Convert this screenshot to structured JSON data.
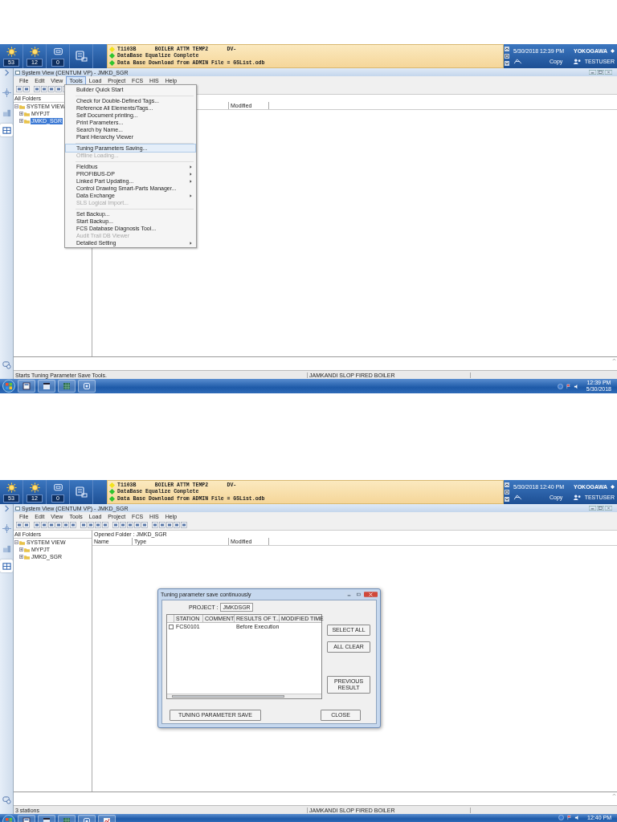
{
  "screens": [
    {
      "header": {
        "buttons": [
          {
            "kind": "alarm",
            "count": "53"
          },
          {
            "kind": "alarm",
            "count": "12"
          },
          {
            "kind": "message",
            "count": "0"
          },
          {
            "kind": "operator"
          }
        ],
        "messages": [
          {
            "text": "T1103B      BOILER ATTM TEMP2      DV-",
            "color": "#f2e21c"
          },
          {
            "text": "DataBase Equalize Complete",
            "color": "#2ec42e"
          },
          {
            "text": "Data Base Download from ADMIN File = GSList.odb",
            "color": "#2ec42e"
          }
        ],
        "datetime": "5/30/2018 12:39 PM",
        "brand": "YOKOGAWA",
        "copy": "Copy",
        "user": "TESTUSER"
      },
      "window": {
        "title": "System View (CENTUM VP) - JMKD_SGR",
        "menu": [
          {
            "label": "File",
            "selected": false
          },
          {
            "label": "Edit",
            "selected": false
          },
          {
            "label": "View",
            "selected": false
          },
          {
            "label": "Tools",
            "selected": true
          },
          {
            "label": "Load",
            "selected": false
          },
          {
            "label": "Project",
            "selected": false
          },
          {
            "label": "FCS",
            "selected": false
          },
          {
            "label": "HIS",
            "selected": false
          },
          {
            "label": "Help",
            "selected": false
          }
        ],
        "tree": {
          "label": "All Folders",
          "children": [
            {
              "label": "SYSTEM VIEW",
              "selected": false,
              "children": [
                {
                  "label": "MYPJT",
                  "selected": false
                },
                {
                  "label": "JMKD_SGR",
                  "selected": true
                }
              ]
            }
          ]
        },
        "columns": [
          {
            "kind": "modified",
            "label": "Modified"
          }
        ],
        "status_left": "Starts Tuning Parameter Save Tools.",
        "status_center": "JAMKANDI SLOP FIRED BOILER"
      },
      "dropdown": [
        {
          "kind": "item",
          "label": "Builder Quick Start",
          "selected": false,
          "disabled": false,
          "submenu": false
        },
        {
          "kind": "separator"
        },
        {
          "kind": "item",
          "label": "Check for Double-Defined Tags...",
          "selected": false,
          "disabled": false,
          "submenu": false
        },
        {
          "kind": "item",
          "label": "Reference All Elements/Tags...",
          "selected": false,
          "disabled": false,
          "submenu": false
        },
        {
          "kind": "item",
          "label": "Self Document printing...",
          "selected": false,
          "disabled": false,
          "submenu": false
        },
        {
          "kind": "item",
          "label": "Print Parameters...",
          "selected": false,
          "disabled": false,
          "submenu": false
        },
        {
          "kind": "item",
          "label": "Search by Name...",
          "selected": false,
          "disabled": false,
          "submenu": false
        },
        {
          "kind": "item",
          "label": "Plant Hierarchy Viewer",
          "selected": false,
          "disabled": false,
          "submenu": false
        },
        {
          "kind": "separator"
        },
        {
          "kind": "item",
          "label": "Tuning Parameters Saving...",
          "selected": true,
          "disabled": false,
          "submenu": false
        },
        {
          "kind": "item",
          "label": "Offline Loading...",
          "selected": false,
          "disabled": true,
          "submenu": false
        },
        {
          "kind": "separator"
        },
        {
          "kind": "item",
          "label": "Fieldbus",
          "selected": false,
          "disabled": false,
          "submenu": true
        },
        {
          "kind": "item",
          "label": "PROFIBUS-DP",
          "selected": false,
          "disabled": false,
          "submenu": true
        },
        {
          "kind": "item",
          "label": "Linked Part Updating...",
          "selected": false,
          "disabled": false,
          "submenu": true
        },
        {
          "kind": "item",
          "label": "Control Drawing Smart-Parts Manager...",
          "selected": false,
          "disabled": false,
          "submenu": false
        },
        {
          "kind": "item",
          "label": "Data Exchange",
          "selected": false,
          "disabled": false,
          "submenu": true
        },
        {
          "kind": "item",
          "label": "SLS Logical Import...",
          "selected": false,
          "disabled": true,
          "submenu": false
        },
        {
          "kind": "separator"
        },
        {
          "kind": "item",
          "label": "Set Backup...",
          "selected": false,
          "disabled": false,
          "submenu": false
        },
        {
          "kind": "item",
          "label": "Start Backup...",
          "selected": false,
          "disabled": false,
          "submenu": false
        },
        {
          "kind": "item",
          "label": "FCS Database Diagnosis Tool...",
          "selected": false,
          "disabled": false,
          "submenu": false
        },
        {
          "kind": "item",
          "label": "Audit Trail DB Viewer",
          "selected": false,
          "disabled": true,
          "submenu": false
        },
        {
          "kind": "item",
          "label": "Detailed Setting",
          "selected": false,
          "disabled": false,
          "submenu": true
        }
      ],
      "taskbar": {
        "apps": [
          {
            "kind": "builder"
          },
          {
            "kind": "clapper"
          },
          {
            "kind": "grid"
          },
          {
            "kind": "monitor"
          }
        ],
        "time": "12:39 PM",
        "date": "5/30/2018"
      }
    },
    {
      "header": {
        "buttons": [
          {
            "kind": "alarm",
            "count": "53"
          },
          {
            "kind": "alarm",
            "count": "12"
          },
          {
            "kind": "message",
            "count": "0"
          },
          {
            "kind": "operator"
          }
        ],
        "messages": [
          {
            "text": "T1103B      BOILER ATTM TEMP2      DV-",
            "color": "#f2e21c"
          },
          {
            "text": "DataBase Equalize Complete",
            "color": "#2ec42e"
          },
          {
            "text": "Data Base Download from ADMIN File = GSList.odb",
            "color": "#2ec42e"
          }
        ],
        "datetime": "5/30/2018 12:40 PM",
        "brand": "YOKOGAWA",
        "copy": "Copy",
        "user": "TESTUSER"
      },
      "window": {
        "title": "System View (CENTUM VP) - JMKD_SGR",
        "menu": [
          {
            "label": "File",
            "selected": false
          },
          {
            "label": "Edit",
            "selected": false
          },
          {
            "label": "View",
            "selected": false
          },
          {
            "label": "Tools",
            "selected": false
          },
          {
            "label": "Load",
            "selected": false
          },
          {
            "label": "Project",
            "selected": false
          },
          {
            "label": "FCS",
            "selected": false
          },
          {
            "label": "HIS",
            "selected": false
          },
          {
            "label": "Help",
            "selected": false
          }
        ],
        "tree": {
          "label": "All Folders",
          "children": [
            {
              "label": "SYSTEM VIEW",
              "selected": false,
              "children": [
                {
                  "label": "MYPJT",
                  "selected": false
                },
                {
                  "label": "JMKD_SGR",
                  "selected": false
                }
              ]
            }
          ]
        },
        "opened_folder": "Opened Folder : JMKD_SGR",
        "columns": [
          {
            "kind": "name",
            "label": "Name"
          },
          {
            "kind": "type",
            "label": "Type"
          },
          {
            "kind": "modified",
            "label": "Modified"
          }
        ],
        "status_left": "3 stations",
        "status_center": "JAMKANDI SLOP FIRED BOILER"
      },
      "dialog": {
        "title": "Tuning parameter save continuously",
        "project_label": "PROJECT :",
        "project": "JMKDSGR",
        "columns": [
          "STATION",
          "COMMENT",
          "RESULTS OF T...",
          "MODIFIED TIME"
        ],
        "rows": [
          {
            "checked": false,
            "station": "FCS0101",
            "result": "Before Execution"
          }
        ],
        "side_buttons": [
          "SELECT ALL",
          "ALL CLEAR",
          "PREVIOUS RESULT"
        ],
        "bottom_buttons": [
          "TUNING PARAMETER SAVE",
          "CLOSE"
        ]
      },
      "taskbar": {
        "apps": [
          {
            "kind": "builder"
          },
          {
            "kind": "clapper"
          },
          {
            "kind": "grid"
          },
          {
            "kind": "monitor"
          },
          {
            "kind": "chart"
          }
        ],
        "time": "12:40 PM"
      }
    }
  ]
}
